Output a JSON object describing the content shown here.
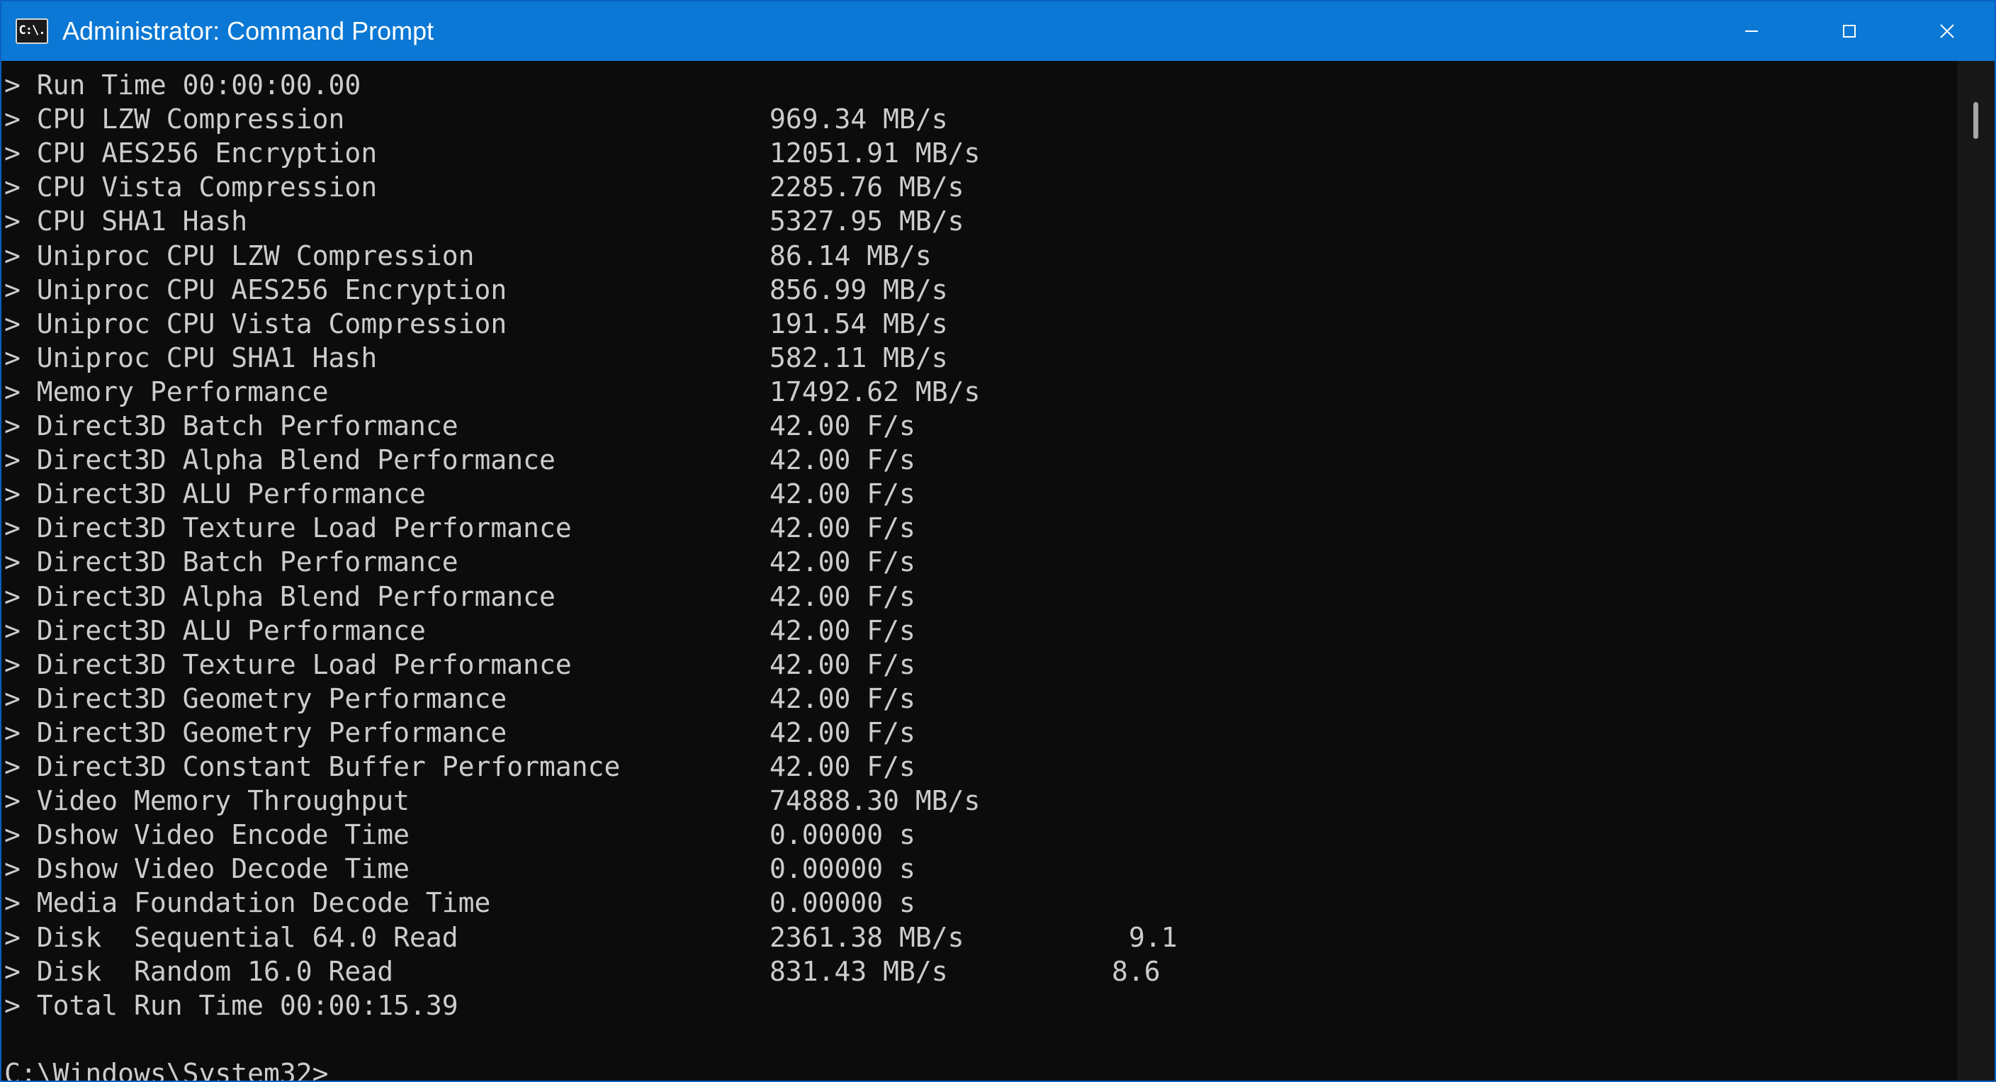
{
  "window": {
    "title": "Administrator: Command Prompt",
    "icon_name": "cmd-icon",
    "icon_text": "C:\\.",
    "accent_color": "#0a78d4",
    "controls": [
      "minimize-icon",
      "maximize-icon",
      "close-icon"
    ]
  },
  "terminal": {
    "background": "#0c0c0c",
    "foreground": "#cccccc",
    "prompt_char": ">",
    "run_time": "> Run Time 00:00:00.00",
    "rows": [
      {
        "label": "> CPU LZW Compression",
        "value": "969.34 MB/s",
        "score": ""
      },
      {
        "label": "> CPU AES256 Encryption",
        "value": "12051.91 MB/s",
        "score": ""
      },
      {
        "label": "> CPU Vista Compression",
        "value": "2285.76 MB/s",
        "score": ""
      },
      {
        "label": "> CPU SHA1 Hash",
        "value": "5327.95 MB/s",
        "score": ""
      },
      {
        "label": "> Uniproc CPU LZW Compression",
        "value": "86.14 MB/s",
        "score": ""
      },
      {
        "label": "> Uniproc CPU AES256 Encryption",
        "value": "856.99 MB/s",
        "score": ""
      },
      {
        "label": "> Uniproc CPU Vista Compression",
        "value": "191.54 MB/s",
        "score": ""
      },
      {
        "label": "> Uniproc CPU SHA1 Hash",
        "value": "582.11 MB/s",
        "score": ""
      },
      {
        "label": "> Memory Performance",
        "value": "17492.62 MB/s",
        "score": ""
      },
      {
        "label": "> Direct3D Batch Performance",
        "value": "42.00 F/s",
        "score": ""
      },
      {
        "label": "> Direct3D Alpha Blend Performance",
        "value": "42.00 F/s",
        "score": ""
      },
      {
        "label": "> Direct3D ALU Performance",
        "value": "42.00 F/s",
        "score": ""
      },
      {
        "label": "> Direct3D Texture Load Performance",
        "value": "42.00 F/s",
        "score": ""
      },
      {
        "label": "> Direct3D Batch Performance",
        "value": "42.00 F/s",
        "score": ""
      },
      {
        "label": "> Direct3D Alpha Blend Performance",
        "value": "42.00 F/s",
        "score": ""
      },
      {
        "label": "> Direct3D ALU Performance",
        "value": "42.00 F/s",
        "score": ""
      },
      {
        "label": "> Direct3D Texture Load Performance",
        "value": "42.00 F/s",
        "score": ""
      },
      {
        "label": "> Direct3D Geometry Performance",
        "value": "42.00 F/s",
        "score": ""
      },
      {
        "label": "> Direct3D Geometry Performance",
        "value": "42.00 F/s",
        "score": ""
      },
      {
        "label": "> Direct3D Constant Buffer Performance",
        "value": "42.00 F/s",
        "score": ""
      },
      {
        "label": "> Video Memory Throughput",
        "value": "74888.30 MB/s",
        "score": ""
      },
      {
        "label": "> Dshow Video Encode Time",
        "value": "0.00000 s",
        "score": ""
      },
      {
        "label": "> Dshow Video Decode Time",
        "value": "0.00000 s",
        "score": ""
      },
      {
        "label": "> Media Foundation Decode Time",
        "value": "0.00000 s",
        "score": ""
      },
      {
        "label": "> Disk  Sequential 64.0 Read",
        "value": "2361.38 MB/s",
        "score": "9.1"
      },
      {
        "label": "> Disk  Random 16.0 Read",
        "value": "831.43 MB/s",
        "score": "8.6"
      }
    ],
    "total_run_time": "> Total Run Time 00:00:15.39",
    "prompt": "C:\\Windows\\System32>"
  }
}
